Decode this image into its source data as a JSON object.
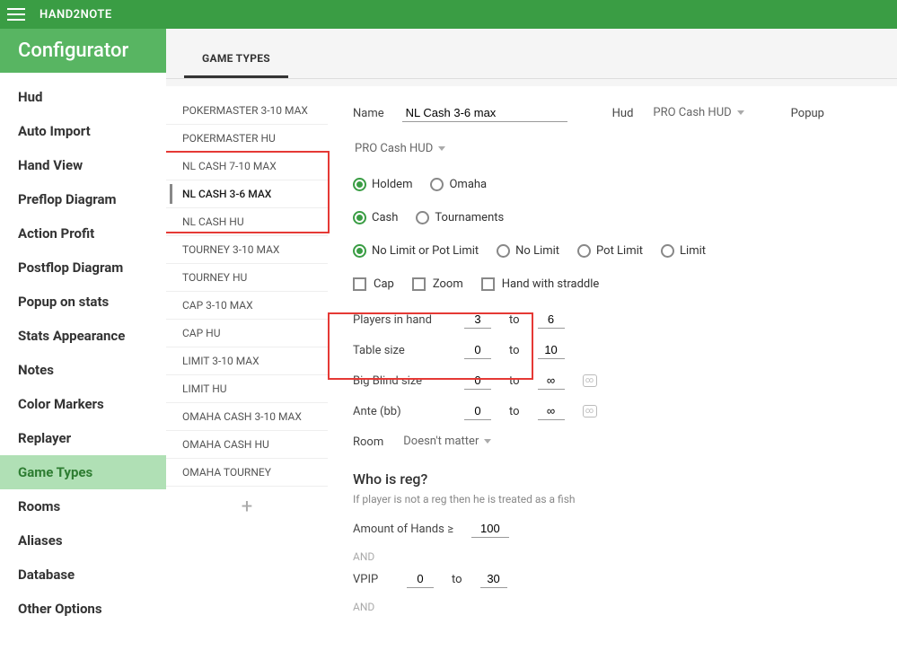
{
  "topbar": {
    "brand": "HAND2NOTE"
  },
  "sidebar": {
    "title": "Configurator",
    "items": [
      {
        "label": "Hud",
        "sel": false
      },
      {
        "label": "Auto Import",
        "sel": false
      },
      {
        "label": "Hand View",
        "sel": false
      },
      {
        "label": "Preflop Diagram",
        "sel": false
      },
      {
        "label": "Action Profit",
        "sel": false
      },
      {
        "label": "Postflop Diagram",
        "sel": false
      },
      {
        "label": "Popup on stats",
        "sel": false
      },
      {
        "label": "Stats Appearance",
        "sel": false
      },
      {
        "label": "Notes",
        "sel": false
      },
      {
        "label": "Color Markers",
        "sel": false
      },
      {
        "label": "Replayer",
        "sel": false
      },
      {
        "label": "Game Types",
        "sel": true
      },
      {
        "label": "Rooms",
        "sel": false
      },
      {
        "label": "Aliases",
        "sel": false
      },
      {
        "label": "Database",
        "sel": false
      },
      {
        "label": "Other Options",
        "sel": false
      }
    ]
  },
  "tabs": [
    {
      "label": "GAME TYPES",
      "active": true
    }
  ],
  "typelist": [
    {
      "label": "POKERMASTER 3-10 MAX",
      "sel": false
    },
    {
      "label": "POKERMASTER HU",
      "sel": false
    },
    {
      "label": "NL CASH 7-10 MAX",
      "sel": false
    },
    {
      "label": "NL CASH 3-6 MAX",
      "sel": true
    },
    {
      "label": "NL CASH HU",
      "sel": false
    },
    {
      "label": "TOURNEY 3-10 MAX",
      "sel": false
    },
    {
      "label": "TOURNEY HU",
      "sel": false
    },
    {
      "label": "CAP 3-10 MAX",
      "sel": false
    },
    {
      "label": "CAP HU",
      "sel": false
    },
    {
      "label": "LIMIT 3-10 MAX",
      "sel": false
    },
    {
      "label": "LIMIT HU",
      "sel": false
    },
    {
      "label": "OMAHA CASH 3-10 MAX",
      "sel": false
    },
    {
      "label": "OMAHA CASH HU",
      "sel": false
    },
    {
      "label": "OMAHA TOURNEY",
      "sel": false
    }
  ],
  "form": {
    "name_label": "Name",
    "name_value": "NL Cash 3-6 max",
    "hud_label": "Hud",
    "hud_value": "PRO Cash HUD",
    "popup_label": "Popup",
    "popup_value": "PRO Cash HUD",
    "variant": {
      "holdem": "Holdem",
      "omaha": "Omaha"
    },
    "format": {
      "cash": "Cash",
      "tourn": "Tournaments"
    },
    "limit": {
      "nlpl": "No Limit or Pot Limit",
      "nl": "No Limit",
      "pl": "Pot Limit",
      "fl": "Limit"
    },
    "flags": {
      "cap": "Cap",
      "zoom": "Zoom",
      "straddle": "Hand with straddle"
    },
    "players": {
      "label": "Players in hand",
      "from": "3",
      "to_word": "to",
      "to": "6"
    },
    "table": {
      "label": "Table size",
      "from": "0",
      "to_word": "to",
      "to": "10"
    },
    "bb": {
      "label": "Big Blind size",
      "from": "0",
      "to_word": "to",
      "to": "∞"
    },
    "ante": {
      "label": "Ante (bb)",
      "from": "0",
      "to_word": "to",
      "to": "∞"
    },
    "room": {
      "label": "Room",
      "value": "Doesn't matter"
    },
    "reg": {
      "title": "Who is reg?",
      "hint": "If player is not a reg then he is treated as a fish",
      "hands_label": "Amount of Hands ≥",
      "hands_value": "100",
      "and": "AND",
      "vpip_label": "VPIP",
      "vpip_from": "0",
      "vpip_to_word": "to",
      "vpip_to": "30"
    }
  }
}
